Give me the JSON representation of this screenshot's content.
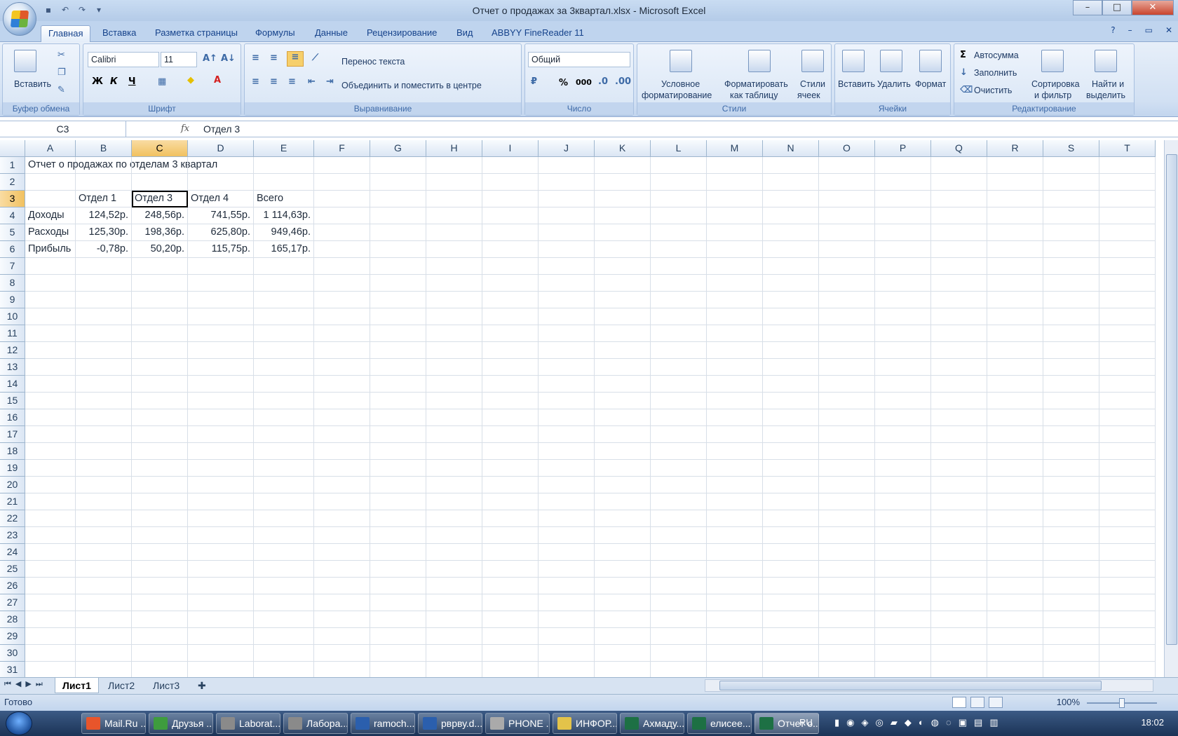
{
  "window": {
    "title": "Отчет о продажах за 3квартал.xlsx - Microsoft Excel",
    "min": "–",
    "max": "□",
    "close": "✕"
  },
  "ribbon_tabs": [
    "Главная",
    "Вставка",
    "Разметка страницы",
    "Формулы",
    "Данные",
    "Рецензирование",
    "Вид",
    "ABBYY FineReader 11"
  ],
  "ribbon": {
    "clipboard": {
      "paste": "Вставить",
      "label": "Буфер обмена"
    },
    "font": {
      "name": "Calibri",
      "size": "11",
      "bold": "Ж",
      "italic": "К",
      "underline": "Ч",
      "label": "Шрифт"
    },
    "alignment": {
      "wrap": "Перенос текста",
      "merge": "Объединить и поместить в центре",
      "label": "Выравнивание"
    },
    "number": {
      "format": "Общий",
      "percent": "%",
      "thousands": "000",
      "label": "Число"
    },
    "styles": {
      "conditional": "Условное",
      "conditional2": "форматирование",
      "as_table": "Форматировать",
      "as_table2": "как таблицу",
      "cell_styles": "Стили",
      "cell_styles2": "ячеек",
      "label": "Стили"
    },
    "cells": {
      "insert": "Вставить",
      "delete": "Удалить",
      "format": "Формат",
      "label": "Ячейки"
    },
    "editing": {
      "autosum": "Автосумма",
      "fill": "Заполнить",
      "clear": "Очистить",
      "sort": "Сортировка",
      "sort2": "и фильтр",
      "find": "Найти и",
      "find2": "выделить",
      "label": "Редактирование"
    }
  },
  "formula_bar": {
    "name_box": "C3",
    "fx": "fx",
    "content": "Отдел 3"
  },
  "columns": [
    "A",
    "B",
    "C",
    "D",
    "E",
    "F",
    "G",
    "H",
    "I",
    "J",
    "K",
    "L",
    "M",
    "N",
    "O",
    "P",
    "Q",
    "R",
    "S",
    "T"
  ],
  "rows": [
    "1",
    "2",
    "3",
    "4",
    "5",
    "6",
    "7",
    "8",
    "9",
    "10",
    "11",
    "12",
    "13",
    "14",
    "15",
    "16",
    "17",
    "18",
    "19",
    "20",
    "21",
    "22",
    "23",
    "24",
    "25",
    "26",
    "27",
    "28",
    "29",
    "30",
    "31"
  ],
  "cells": {
    "A1": "Отчет о продажах по отделам 3 квартал",
    "B3": "Отдел 1",
    "C3": "Отдел 3",
    "D3": "Отдел 4",
    "E3": "Всего",
    "A4": "Доходы",
    "B4": "124,52р.",
    "C4": "248,56р.",
    "D4": "741,55р.",
    "E4": "1 114,63р.",
    "A5": "Расходы",
    "B5": "125,30р.",
    "C5": "198,36р.",
    "D5": "625,80р.",
    "E5": "949,46р.",
    "A6": "Прибыль",
    "B6": "-0,78р.",
    "C6": "50,20р.",
    "D6": "115,75р.",
    "E6": "165,17р."
  },
  "sheets": [
    "Лист1",
    "Лист2",
    "Лист3"
  ],
  "status": {
    "ready": "Готово",
    "zoom": "100%",
    "zoom_level_percent": 100
  },
  "taskbar": {
    "items": [
      "Mail.Ru ...",
      "Друзья ...",
      "Laborat...",
      "Лабора...",
      "ramoch...",
      "рврву.d...",
      "PHONE ...",
      "ИНФОР...",
      "Ахмаду...",
      "елисее...",
      "Отчет о..."
    ],
    "lang": "RU",
    "time": "18:02"
  },
  "colors": {
    "accent": "#15428b",
    "selected_header": "#f1c15f",
    "excel_green": "#1d7044"
  }
}
